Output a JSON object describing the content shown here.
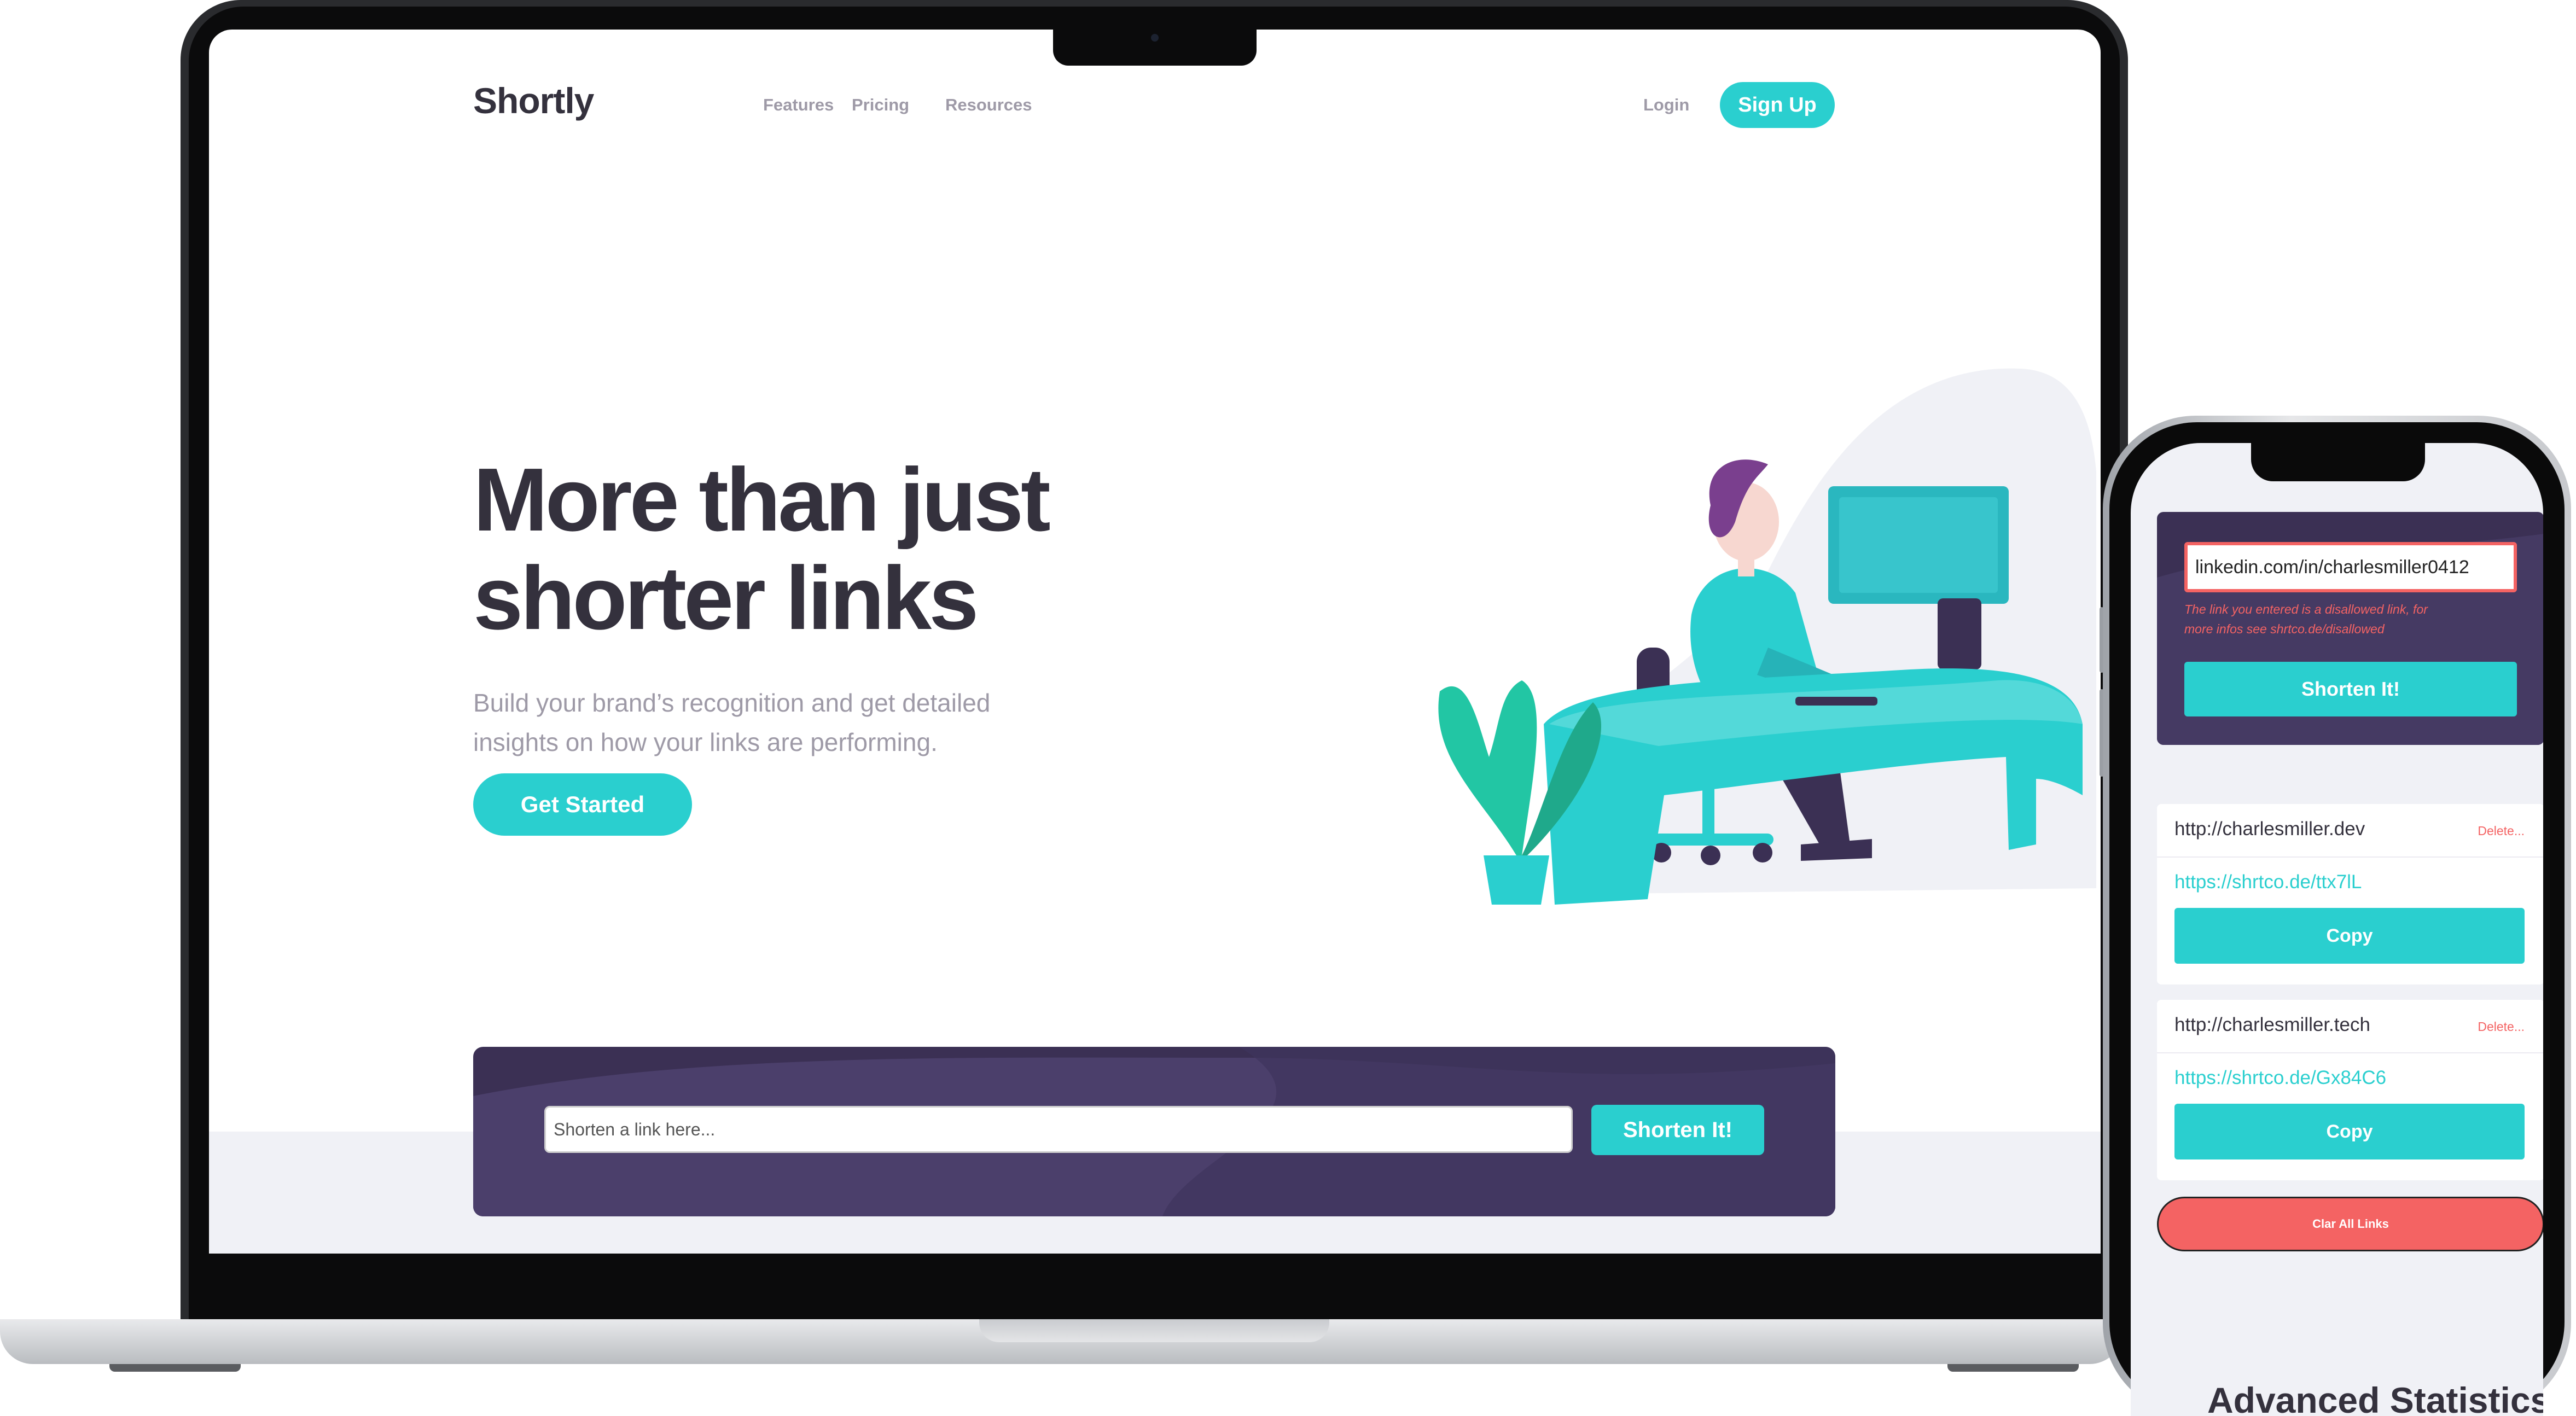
{
  "desktop": {
    "brand": "Shortly",
    "nav": {
      "features": "Features",
      "pricing": "Pricing",
      "resources": "Resources",
      "login": "Login",
      "signup": "Sign Up"
    },
    "hero": {
      "title_line1": "More than just",
      "title_line2": "shorter links",
      "subtitle_line1": "Build your brand’s recognition and get detailed",
      "subtitle_line2": "insights on how your links are performing.",
      "cta": "Get Started"
    },
    "shorten": {
      "placeholder": "Shorten a link here...",
      "button": "Shorten It!"
    }
  },
  "mobile": {
    "shorten": {
      "input_value": "linkedin.com/in/charlesmiller0412",
      "error_line1": "The link you entered is a disallowed link, for",
      "error_line2": "more infos see shrtco.de/disallowed",
      "button": "Shorten It!"
    },
    "links": [
      {
        "original": "http://charlesmiller.dev",
        "delete": "Delete...",
        "short": "https://shrtco.de/ttx7lL",
        "copy": "Copy"
      },
      {
        "original": "http://charlesmiller.tech",
        "delete": "Delete...",
        "short": "https://shrtco.de/Gx84C6",
        "copy": "Copy"
      }
    ],
    "clear_all": "Clar All Links",
    "section_peek": "Advanced Statistics"
  },
  "colors": {
    "primary_cyan": "#2acfcf",
    "dark_violet": "#3b3054",
    "heading_dark": "#34313d",
    "gray_text": "#9e9aa7",
    "error_red": "#f46363",
    "light_bg": "#f0f1f6"
  }
}
